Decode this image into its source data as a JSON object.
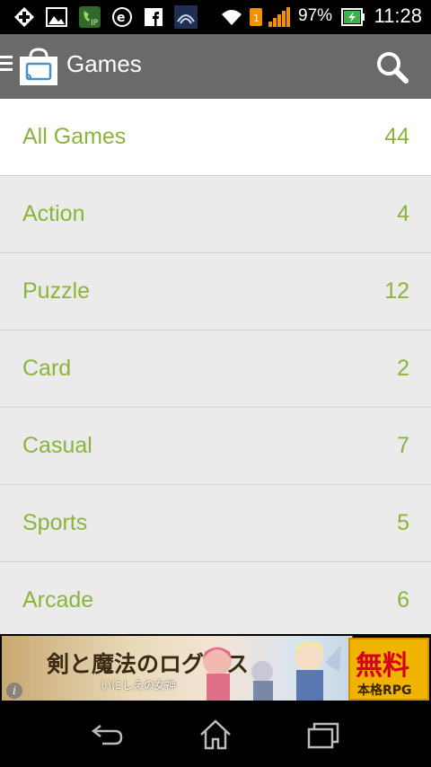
{
  "status_bar": {
    "time": "11:28",
    "battery_percent": "97%",
    "notification_icons": [
      "add-icon",
      "image-icon",
      "ip-phone-icon",
      "e-icon",
      "facebook-icon",
      "tuning-icon"
    ],
    "system_icons": [
      "wifi-icon",
      "sim-icon",
      "signal-icon",
      "battery-icon"
    ]
  },
  "action_bar": {
    "title": "Games",
    "search_icon": "search-icon",
    "background": "#6a6a6a"
  },
  "categories": [
    {
      "label": "All Games",
      "count": "44"
    },
    {
      "label": "Action",
      "count": "4"
    },
    {
      "label": "Puzzle",
      "count": "12"
    },
    {
      "label": "Card",
      "count": "2"
    },
    {
      "label": "Casual",
      "count": "7"
    },
    {
      "label": "Sports",
      "count": "5"
    },
    {
      "label": "Arcade",
      "count": "6"
    }
  ],
  "colors": {
    "accent_green": "#8ab43a",
    "list_bg": "#ebebeb",
    "selected_bg": "#ffffff"
  },
  "ad": {
    "title": "剣と魔法のログレス",
    "subtitle": "いにしえの女神",
    "badge_main": "無料",
    "badge_sub": "本格RPG"
  },
  "nav_bar": {
    "buttons": [
      "back-icon",
      "home-icon",
      "recent-apps-icon"
    ]
  }
}
